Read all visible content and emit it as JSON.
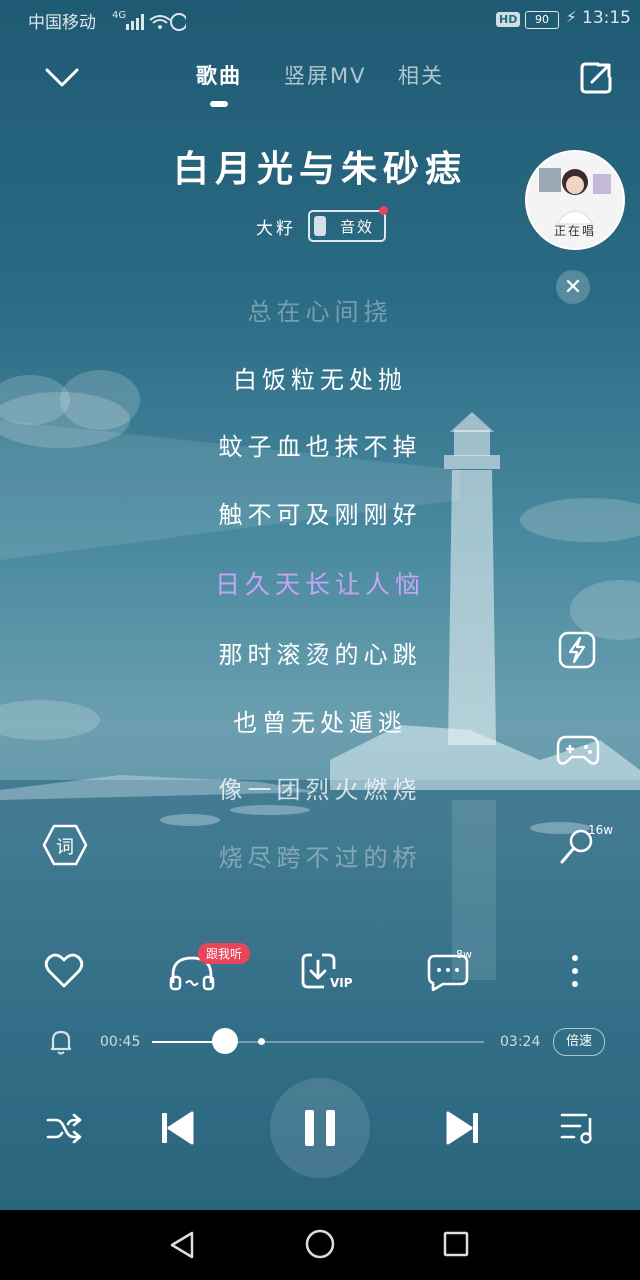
{
  "status_bar": {
    "carrier": "中国移动",
    "network": "4G",
    "battery": "90",
    "time": "13:15",
    "hd_badge": "HD"
  },
  "tabs": [
    {
      "label": "歌曲",
      "active": true
    },
    {
      "label": "竖屏MV",
      "active": false
    },
    {
      "label": "相关",
      "active": false
    }
  ],
  "song": {
    "title": "白月光与朱砂痣",
    "artist": "大籽",
    "effect_label": "音效"
  },
  "singing_avatar": {
    "label": "正在唱"
  },
  "lyrics": [
    {
      "text": "总在心间挠",
      "state": "dim"
    },
    {
      "text": "白饭粒无处抛",
      "state": "normal"
    },
    {
      "text": "蚊子血也抹不掉",
      "state": "normal"
    },
    {
      "text": "触不可及刚刚好",
      "state": "normal"
    },
    {
      "text": "日久天长让人恼",
      "state": "active"
    },
    {
      "text": "那时滚烫的心跳",
      "state": "normal"
    },
    {
      "text": "也曾无处遁逃",
      "state": "normal"
    },
    {
      "text": "像一团烈火燃烧",
      "state": "normal"
    },
    {
      "text": "烧尽跨不过的桥",
      "state": "dim"
    }
  ],
  "side_buttons": {
    "lyrics_button": "词",
    "mic_count": "16w"
  },
  "actions": {
    "listen_badge": "跟我听",
    "download_vip": "VIP",
    "comment_count": "8w"
  },
  "playback": {
    "current_time": "00:45",
    "total_time": "03:24",
    "progress": 0.22,
    "speed_label": "倍速"
  },
  "colors": {
    "accent_lyric": "#c6a3f5",
    "badge_red": "#e8455a"
  }
}
